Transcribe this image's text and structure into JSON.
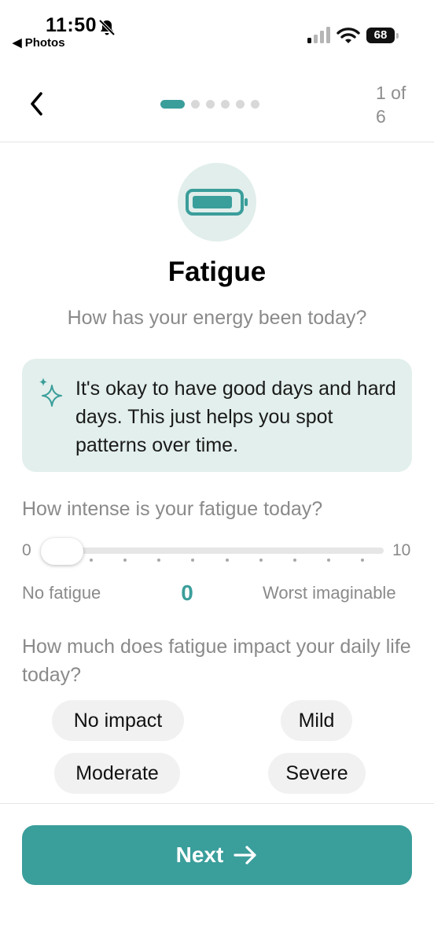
{
  "status_bar": {
    "time": "11:50",
    "back_app": "◀ Photos",
    "battery_level": "68"
  },
  "header": {
    "step_label": "1 of 6",
    "current_step": 1,
    "total_steps": 6
  },
  "screen": {
    "title": "Fatigue",
    "subtitle": "How has your energy been today?",
    "tip_text": "It's okay to have good days and hard days. This just helps you spot patterns over time."
  },
  "intensity": {
    "question": "How intense is your fatigue today?",
    "min_label": "0",
    "max_label": "10",
    "low_label": "No fatigue",
    "high_label": "Worst imaginable",
    "value": "0",
    "min": 0,
    "max": 10
  },
  "impact": {
    "question": "How much does fatigue impact your daily life today?",
    "options": [
      "No impact",
      "Mild",
      "Moderate",
      "Severe"
    ]
  },
  "next_button": {
    "label": "Next"
  },
  "colors": {
    "accent": "#3a9e9b",
    "accent_light": "#e1eeeb",
    "muted_text": "#8a8a8a"
  }
}
